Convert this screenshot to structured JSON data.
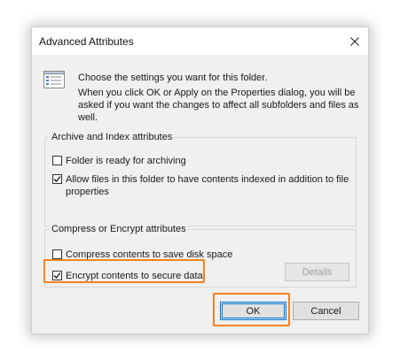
{
  "dialog": {
    "title": "Advanced Attributes",
    "description_line1": "Choose the settings you want for this folder.",
    "description_line2": "When you click OK or Apply on the Properties dialog, you will be asked if you want the changes to affect all subfolders and files as well."
  },
  "archive_group": {
    "legend": "Archive and Index attributes",
    "folder_ready": {
      "label": "Folder is ready for archiving",
      "checked": false
    },
    "allow_index": {
      "label": "Allow files in this folder to have contents indexed in addition to file properties",
      "checked": true
    }
  },
  "compress_group": {
    "legend": "Compress or Encrypt attributes",
    "compress": {
      "label": "Compress contents to save disk space",
      "checked": false
    },
    "encrypt": {
      "label": "Encrypt contents to secure data",
      "checked": true
    },
    "details_label": "Details"
  },
  "buttons": {
    "ok": "OK",
    "cancel": "Cancel"
  },
  "colors": {
    "highlight": "#f5821f",
    "focus": "#0078d7",
    "dialog_bg": "#f0f0f0"
  },
  "icons": {
    "close": "close-icon",
    "folder_settings": "list-settings-icon",
    "check": "checkmark-icon"
  }
}
